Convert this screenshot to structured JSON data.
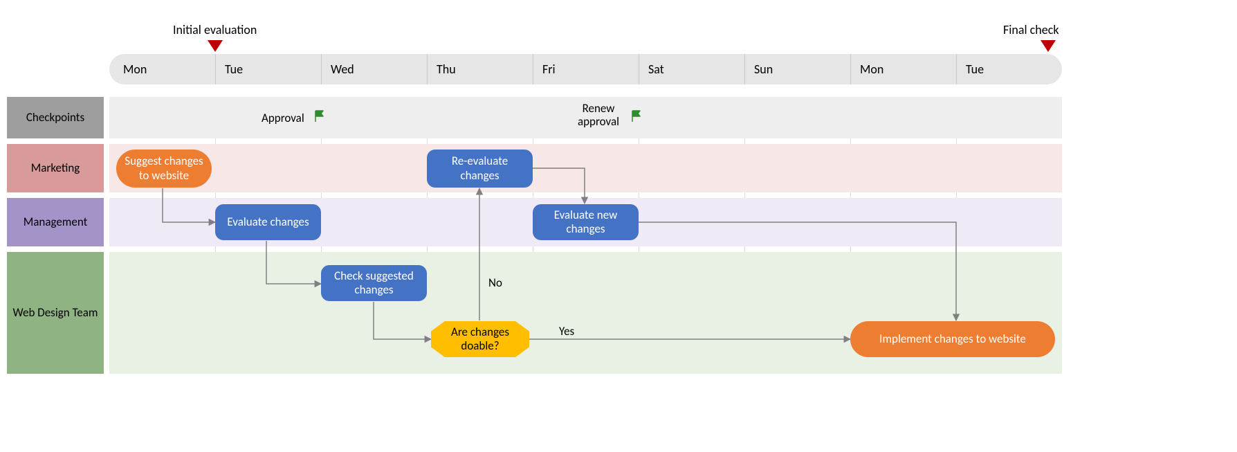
{
  "chart_data": {
    "type": "swimlane-flow",
    "days": [
      "Mon",
      "Tue",
      "Wed",
      "Thu",
      "Fri",
      "Sat",
      "Sun",
      "Mon",
      "Tue"
    ],
    "milestones": [
      {
        "id": "initial_eval",
        "label": "Initial evaluation",
        "day_index": 1
      },
      {
        "id": "final_check",
        "label": "Final check",
        "day_index": 8.9
      }
    ],
    "lanes": [
      {
        "id": "checkpoints",
        "label": "Checkpoints",
        "header_color": "#9e9e9e",
        "body_color": "#eeeeee"
      },
      {
        "id": "marketing",
        "label": "Marketing",
        "header_color": "#d89a9a",
        "body_color": "#f7e7e7"
      },
      {
        "id": "management",
        "label": "Management",
        "header_color": "#a393c9",
        "body_color": "#efeaf6"
      },
      {
        "id": "webdesign",
        "label": "Web Design Team",
        "header_color": "#8fb382",
        "body_color": "#e9f0e4"
      }
    ],
    "checkpoints": [
      {
        "id": "approval",
        "label": "Approval",
        "lane": "checkpoints",
        "near_day": 2
      },
      {
        "id": "renew_approval",
        "label": "Renew approval",
        "lane": "checkpoints",
        "near_day": 5
      }
    ],
    "nodes": [
      {
        "id": "suggest",
        "label": "Suggest changes to website",
        "lane": "marketing",
        "shape": "pill",
        "color": "orange",
        "day_start": 0.1,
        "day_end": 1.0
      },
      {
        "id": "evaluate",
        "label": "Evaluate changes",
        "lane": "management",
        "shape": "rounded",
        "color": "blue",
        "day_start": 1.0,
        "day_end": 2.0
      },
      {
        "id": "check",
        "label": "Check suggested changes",
        "lane": "webdesign",
        "shape": "rounded",
        "color": "blue",
        "day_start": 2.0,
        "day_end": 3.0
      },
      {
        "id": "decision",
        "label": "Are changes doable?",
        "lane": "webdesign",
        "shape": "decision",
        "color": "yellow",
        "day_start": 3.05,
        "day_end": 3.95
      },
      {
        "id": "reeval",
        "label": "Re-evaluate changes",
        "lane": "marketing",
        "shape": "rounded",
        "color": "blue",
        "day_start": 3.0,
        "day_end": 4.0
      },
      {
        "id": "eval_new",
        "label": "Evaluate new changes",
        "lane": "management",
        "shape": "rounded",
        "color": "blue",
        "day_start": 4.0,
        "day_end": 5.0
      },
      {
        "id": "implement",
        "label": "Implement changes to website",
        "lane": "webdesign",
        "shape": "pill",
        "color": "orange",
        "day_start": 7.0,
        "day_end": 9.0
      }
    ],
    "edges": [
      {
        "from": "suggest",
        "to": "evaluate"
      },
      {
        "from": "evaluate",
        "to": "check"
      },
      {
        "from": "check",
        "to": "decision"
      },
      {
        "from": "decision",
        "to": "reeval",
        "label": "No"
      },
      {
        "from": "decision",
        "to": "implement",
        "label": "Yes"
      },
      {
        "from": "reeval",
        "to": "eval_new"
      },
      {
        "from": "eval_new",
        "to": "implement"
      }
    ]
  },
  "labels": {
    "no": "No",
    "yes": "Yes"
  }
}
